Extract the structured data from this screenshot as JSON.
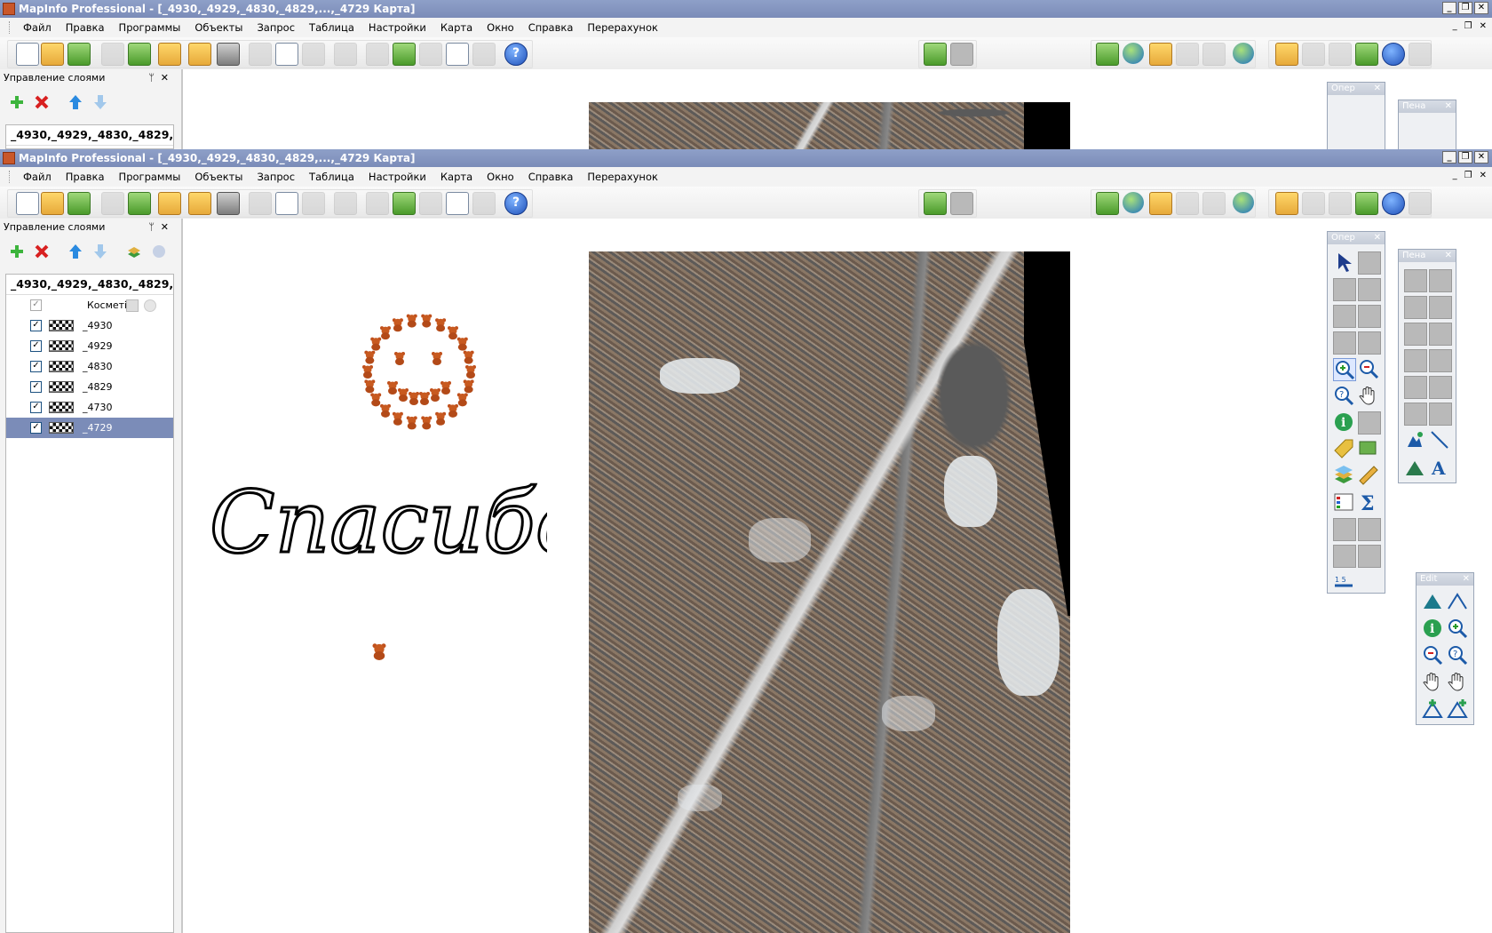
{
  "app": {
    "window_title": "MapInfo Professional - [_4930,_4929,_4830,_4829,...,_4729 Карта]"
  },
  "menu": [
    "Файл",
    "Правка",
    "Программы",
    "Объекты",
    "Запрос",
    "Таблица",
    "Настройки",
    "Карта",
    "Окно",
    "Справка",
    "Перерахунок"
  ],
  "layer_panel": {
    "title": "Управление слоями",
    "map_name": "_4930,_4929,_4830,_4829,",
    "layers": [
      {
        "name": "Косметі",
        "checked": true,
        "cosmetic": true
      },
      {
        "name": "_4930",
        "checked": true
      },
      {
        "name": "_4929",
        "checked": true
      },
      {
        "name": "_4830",
        "checked": true
      },
      {
        "name": "_4829",
        "checked": true
      },
      {
        "name": "_4730",
        "checked": true
      },
      {
        "name": "_4729",
        "checked": true,
        "selected": true
      }
    ]
  },
  "palettes": {
    "oper_title": "Опер",
    "pen_title": "Пена",
    "edit_title": "Edit"
  },
  "map": {
    "handwritten_text": "Спасибо"
  },
  "colors": {
    "title_bar": "#7b8cb8",
    "selection": "#7b8cb8"
  }
}
